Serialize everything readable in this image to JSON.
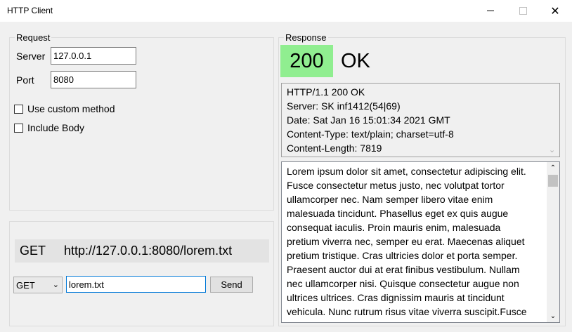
{
  "window": {
    "title": "HTTP Client",
    "minimize_glyph": "",
    "maximize_glyph": "",
    "close_glyph": "✕"
  },
  "request": {
    "legend": "Request",
    "server_label": "Server",
    "server_value": "127.0.0.1",
    "port_label": "Port",
    "port_value": "8080",
    "custom_method_label": "Use custom method",
    "custom_method_checked": false,
    "include_body_label": "Include Body",
    "include_body_checked": false,
    "url_method": "GET",
    "url": "http://127.0.0.1:8080/lorem.txt",
    "method_select": "GET",
    "path_value": "lorem.txt",
    "send_label": "Send"
  },
  "response": {
    "legend": "Response",
    "status_code": "200",
    "status_text": "OK",
    "status_color": "#90ee90",
    "headers": [
      "HTTP/1.1 200 OK",
      "Server: SK inf1412(54|69)",
      "Date: Sat Jan 16 15:01:34 2021 GMT",
      "Content-Type: text/plain; charset=utf-8",
      "Content-Length: 7819"
    ],
    "body_lines": [
      "Lorem ipsum dolor sit amet, consectetur adipiscing elit.",
      "Fusce consectetur metus justo, nec volutpat tortor",
      "ullamcorper nec. Nam semper libero vitae enim",
      "malesuada tincidunt. Phasellus eget ex quis augue",
      "consequat iaculis. Proin mauris enim, malesuada",
      "pretium viverra nec, semper eu erat. Maecenas aliquet",
      "pretium tristique. Cras ultricies dolor et porta semper.",
      "Praesent auctor dui at erat finibus vestibulum. Nullam",
      "nec ullamcorper nisi. Quisque consectetur augue non",
      "ultrices ultrices. Cras dignissim mauris at tincidunt",
      "vehicula. Nunc rutrum risus vitae viverra suscipit.Fusce"
    ]
  }
}
